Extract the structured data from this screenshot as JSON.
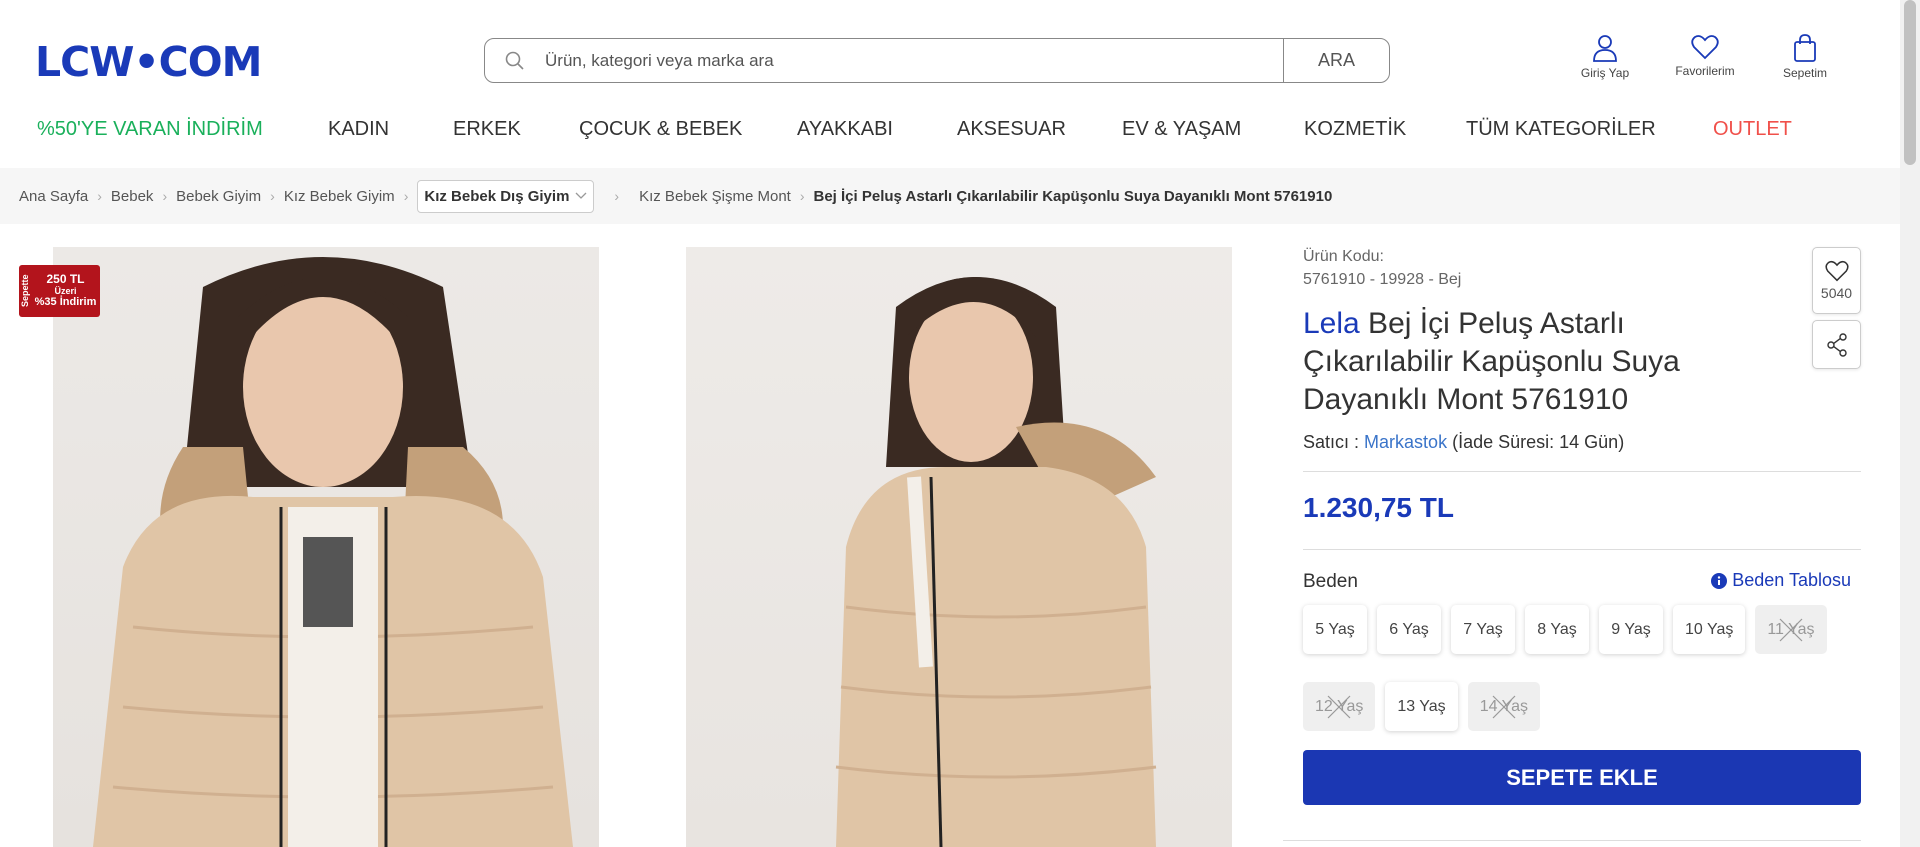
{
  "header": {
    "logo": "LCW•COM",
    "search_placeholder": "Ürün, kategori veya marka ara",
    "search_button": "ARA",
    "icons": [
      {
        "label": "Giriş Yap",
        "icon": "user-icon"
      },
      {
        "label": "Favorilerim",
        "icon": "heart-icon"
      },
      {
        "label": "Sepetim",
        "icon": "bag-icon"
      }
    ]
  },
  "nav": [
    "%50'YE VARAN İNDİRİM",
    "KADIN",
    "ERKEK",
    "ÇOCUK & BEBEK",
    "AYAKKABI",
    "AKSESUAR",
    "EV & YAŞAM",
    "KOZMETİK",
    "TÜM KATEGORİLER",
    "OUTLET"
  ],
  "breadcrumb": {
    "items": [
      "Ana Sayfa",
      "Bebek",
      "Bebek Giyim",
      "Kız Bebek Giyim"
    ],
    "dropdown": "Kız Bebek Dış Giyim",
    "after": "Kız Bebek Şişme Mont",
    "current": "Bej İçi Peluş Astarlı Çıkarılabilir Kapüşonlu Suya Dayanıklı Mont 5761910"
  },
  "badge": {
    "vertical": "Sepette",
    "line1": "250 TL",
    "line2": "Üzeri",
    "line3": "%35 İndirim"
  },
  "product": {
    "code_label": "Ürün Kodu:",
    "code_value": "5761910 - 19928 - Bej",
    "brand": "Lela",
    "title": " Bej İçi Peluş Astarlı Çıkarılabilir Kapüşonlu Suya Dayanıklı Mont 5761910",
    "seller_label": "Satıcı :",
    "seller_name": "Markastok",
    "return_info": "(İade Süresi: 14 Gün)",
    "price": "1.230,75 TL",
    "size_label": "Beden",
    "size_table": "Beden Tablosu",
    "sizes": [
      {
        "label": "5 Yaş",
        "available": true
      },
      {
        "label": "6 Yaş",
        "available": true
      },
      {
        "label": "7 Yaş",
        "available": true
      },
      {
        "label": "8 Yaş",
        "available": true
      },
      {
        "label": "9 Yaş",
        "available": true
      },
      {
        "label": "10 Yaş",
        "available": true
      },
      {
        "label": "11 Yaş",
        "available": false
      },
      {
        "label": "12 Yaş",
        "available": false
      },
      {
        "label": "13 Yaş",
        "available": true
      },
      {
        "label": "14 Yaş",
        "available": false
      }
    ],
    "add_to_cart": "SEPETE EKLE",
    "favorites_count": "5040"
  },
  "colors": {
    "brand_blue": "#1a3ab8",
    "button_blue": "#1b37b3",
    "discount_green": "#1ab05b",
    "outlet_red": "#f0504a",
    "badge_red": "#b3141c"
  }
}
